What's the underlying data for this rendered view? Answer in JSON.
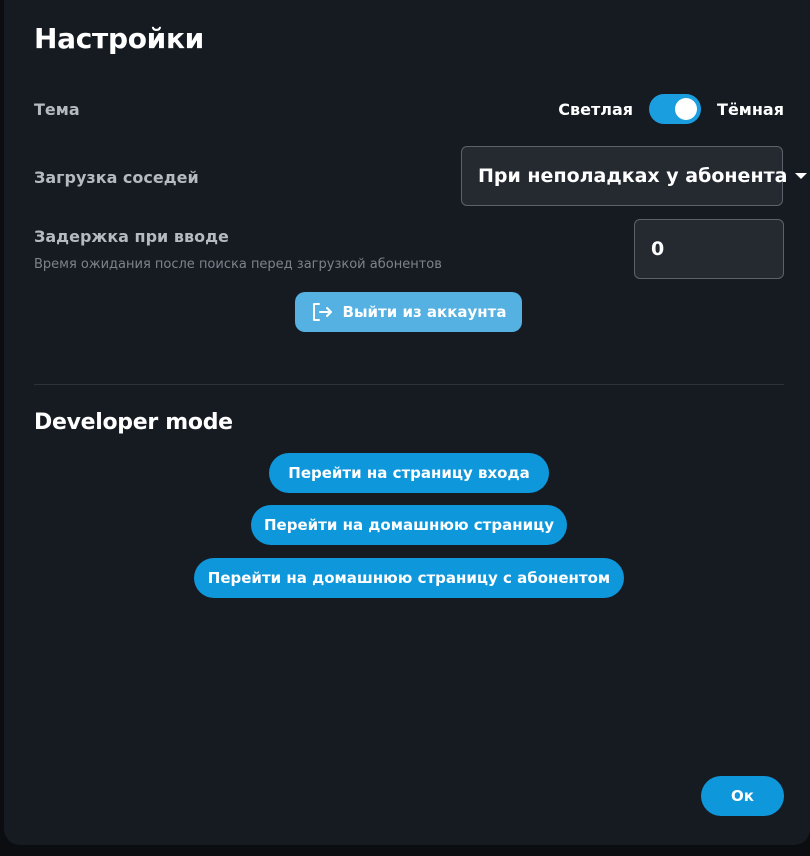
{
  "dialog": {
    "title": "Настройки"
  },
  "theme": {
    "label": "Тема",
    "light_label": "Светлая",
    "dark_label": "Тёмная",
    "selected": "dark"
  },
  "neighbors": {
    "label": "Загрузка соседей",
    "value": "При неполадках у абонента"
  },
  "input_delay": {
    "label": "Задержка при вводе",
    "description": "Время ожидания после поиска перед загрузкой абонентов",
    "value": "0"
  },
  "logout": {
    "label": "Выйти из аккаунта",
    "icon": "logout-icon"
  },
  "developer": {
    "title": "Developer mode",
    "buttons": [
      {
        "label": "Перейти на страницу входа"
      },
      {
        "label": "Перейти на домашнюю страницу"
      },
      {
        "label": "Перейти на домашнюю страницу с абонентом"
      }
    ]
  },
  "footer": {
    "ok_label": "Ок"
  },
  "colors": {
    "accent": "#0f97db",
    "dialog_bg": "#161b22",
    "logout_bg": "#54b1e1"
  }
}
